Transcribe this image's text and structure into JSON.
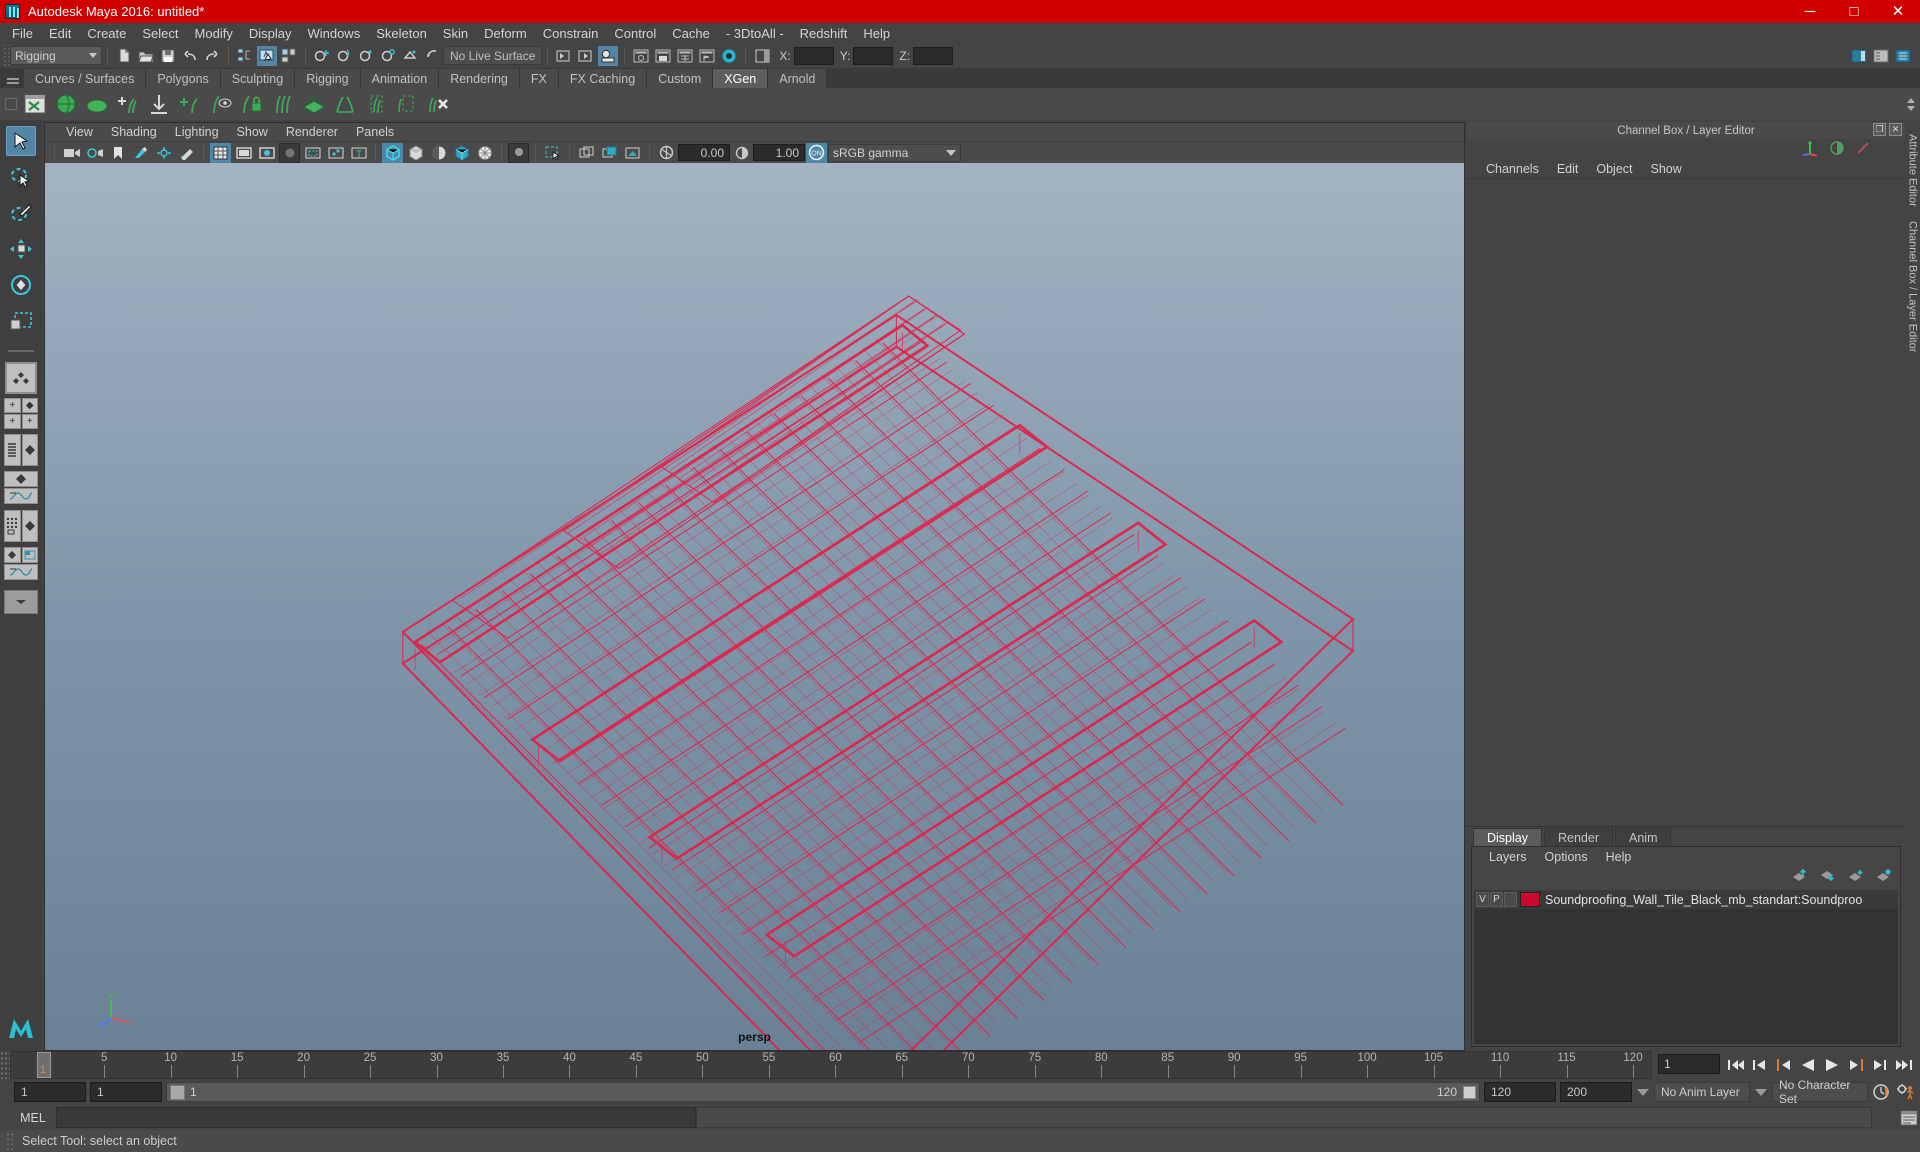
{
  "window": {
    "title": "Autodesk Maya 2016: untitled*",
    "app_icon": "maya-logo-icon",
    "minimize_label": "─",
    "maximize_label": "□",
    "close_label": "✕",
    "titlebar_color": "#d00000"
  },
  "menubar": {
    "items": [
      "File",
      "Edit",
      "Create",
      "Select",
      "Modify",
      "Display",
      "Windows",
      "Skeleton",
      "Skin",
      "Deform",
      "Constrain",
      "Control",
      "Cache",
      "- 3DtoAll -",
      "Redshift",
      "Help"
    ]
  },
  "statusline": {
    "menuset": "Rigging",
    "live_surface": "No Live Surface",
    "coord_x_label": "X:",
    "coord_y_label": "Y:",
    "coord_z_label": "Z:",
    "coord_x_value": "",
    "coord_y_value": "",
    "coord_z_value": ""
  },
  "shelf": {
    "tabs": [
      "Curves / Surfaces",
      "Polygons",
      "Sculpting",
      "Rigging",
      "Animation",
      "Rendering",
      "FX",
      "FX Caching",
      "Custom",
      "XGen",
      "Arnold"
    ],
    "active_tab": "XGen",
    "icon_count": 15
  },
  "toolbox": {
    "tools": [
      "select-tool",
      "lasso-select-tool",
      "paint-select-tool",
      "move-tool",
      "rotate-tool",
      "scale-tool"
    ],
    "active_tool": "select-tool",
    "layout_presets": [
      "single-perspective-layout",
      "four-view-layout",
      "outliner-persp-layout",
      "persp-graph-layout",
      "hypershade-persp-layout",
      "persp-outliner-graph-layout"
    ]
  },
  "viewport": {
    "panel_menus": [
      "View",
      "Shading",
      "Lighting",
      "Show",
      "Renderer",
      "Panels"
    ],
    "camera_label": "persp",
    "exposure_value": "0.00",
    "gamma_value": "1.00",
    "color_management": "sRGB gamma",
    "color_mgmt_toggle": "ON",
    "background_top": "#9fb0c0",
    "background_bottom": "#6b8296",
    "wireframe_color": "#e0234a",
    "axis_x": "x",
    "axis_y": "y",
    "axis_z": "z"
  },
  "channelbox": {
    "title": "Channel Box / Layer Editor",
    "menus": [
      "Channels",
      "Edit",
      "Object",
      "Show"
    ],
    "restore_label": "❐",
    "close_label": "✕"
  },
  "layer_editor": {
    "tabs": [
      "Display",
      "Render",
      "Anim"
    ],
    "active_tab": "Display",
    "menus": [
      "Layers",
      "Options",
      "Help"
    ],
    "layers": [
      {
        "visibility": "V",
        "playback": "P",
        "shading": "",
        "color": "#cc0a2e",
        "name": "Soundproofing_Wall_Tile_Black_mb_standart:Soundproo"
      }
    ]
  },
  "right_dock": {
    "vertical_labels": [
      "Attribute Editor",
      "Channel Box / Layer Editor"
    ]
  },
  "timeline": {
    "current_frame": "1",
    "ticks": [
      5,
      10,
      15,
      20,
      25,
      30,
      35,
      40,
      45,
      50,
      55,
      60,
      65,
      70,
      75,
      80,
      85,
      90,
      95,
      100,
      105,
      110,
      115,
      120
    ],
    "start": 1,
    "end": 120,
    "playback_buttons": [
      "go-to-start",
      "step-back-key",
      "step-back-frame",
      "play-backwards",
      "play-forwards",
      "step-forward-frame",
      "step-forward-key",
      "go-to-end"
    ]
  },
  "range_slider": {
    "anim_start": "1",
    "playback_start": "1",
    "slider_left_label": "1",
    "slider_right_label": "120",
    "playback_end": "120",
    "anim_end": "200",
    "anim_layer": "No Anim Layer",
    "character_set": "No Character Set"
  },
  "command_line": {
    "language_label": "MEL",
    "input_value": "",
    "output_value": ""
  },
  "help_line": {
    "text": "Select Tool: select an object"
  }
}
